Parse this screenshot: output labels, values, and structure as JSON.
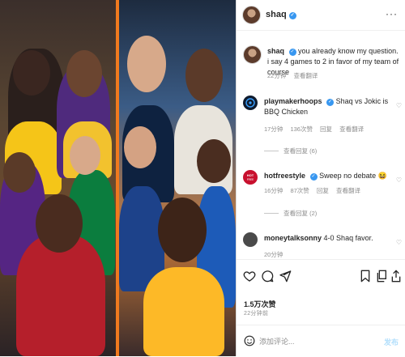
{
  "header": {
    "username": "shaq",
    "verified_mark": "✓"
  },
  "caption": {
    "username": "shaq",
    "text": "you already know my question. i say 4 games to 2 in favor of my team of course",
    "time": "22分钟",
    "translate": "查看翻译"
  },
  "comments": [
    {
      "username": "playmakerhoops",
      "text": "Shaq vs Jokic is BBQ Chicken",
      "time": "17分钟",
      "likes": "136次赞",
      "reply": "回复",
      "translate": "查看翻译",
      "view_replies": "查看回复 (6)",
      "avatar_color": "#0f1b2e"
    },
    {
      "username": "hotfreestyle",
      "text": "Sweep no debate 😆",
      "time": "16分钟",
      "likes": "87次赞",
      "reply": "回复",
      "translate": "查看翻译",
      "view_replies": "查看回复 (2)",
      "avatar_color": "#c8102e"
    },
    {
      "username": "moneytalksonny",
      "text": "4-0 Shaq favor.",
      "time": "20分钟",
      "avatar_color": "#4a4a4a"
    }
  ],
  "actions": {
    "like_icon": "heart-icon",
    "comment_icon": "comment-icon",
    "share_icon": "send-icon",
    "bookmark_icon": "bookmark-icon"
  },
  "stats": {
    "likes": "1.5万次赞",
    "posted_ago": "22分钟前"
  },
  "add_comment": {
    "placeholder": "添加评论...",
    "post_label": "发布"
  },
  "colors": {
    "accent_blue": "#3897f0",
    "divider_orange": "#f07a1e"
  }
}
